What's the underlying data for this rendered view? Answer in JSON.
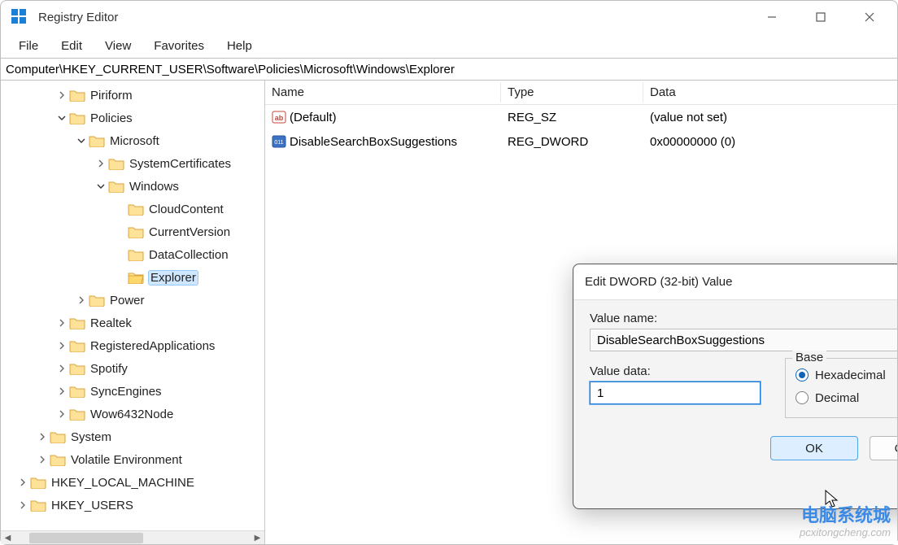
{
  "title": "Registry Editor",
  "menubar": [
    "File",
    "Edit",
    "View",
    "Favorites",
    "Help"
  ],
  "address": "Computer\\HKEY_CURRENT_USER\\Software\\Policies\\Microsoft\\Windows\\Explorer",
  "tree": [
    {
      "indent": 48,
      "exp": "right",
      "label": "Piriform"
    },
    {
      "indent": 48,
      "exp": "down",
      "label": "Policies"
    },
    {
      "indent": 72,
      "exp": "down",
      "label": "Microsoft"
    },
    {
      "indent": 96,
      "exp": "right",
      "label": "SystemCertificates"
    },
    {
      "indent": 96,
      "exp": "down",
      "label": "Windows"
    },
    {
      "indent": 120,
      "exp": "",
      "label": "CloudContent"
    },
    {
      "indent": 120,
      "exp": "",
      "label": "CurrentVersion"
    },
    {
      "indent": 120,
      "exp": "",
      "label": "DataCollection"
    },
    {
      "indent": 120,
      "exp": "",
      "label": "Explorer",
      "selected": true,
      "open": true
    },
    {
      "indent": 72,
      "exp": "right",
      "label": "Power"
    },
    {
      "indent": 48,
      "exp": "right",
      "label": "Realtek"
    },
    {
      "indent": 48,
      "exp": "right",
      "label": "RegisteredApplications"
    },
    {
      "indent": 48,
      "exp": "right",
      "label": "Spotify"
    },
    {
      "indent": 48,
      "exp": "right",
      "label": "SyncEngines"
    },
    {
      "indent": 48,
      "exp": "right",
      "label": "Wow6432Node"
    },
    {
      "indent": 24,
      "exp": "right",
      "label": "System"
    },
    {
      "indent": 24,
      "exp": "right",
      "label": "Volatile Environment"
    },
    {
      "indent": 0,
      "exp": "right",
      "label": "HKEY_LOCAL_MACHINE"
    },
    {
      "indent": 0,
      "exp": "right",
      "label": "HKEY_USERS"
    }
  ],
  "list": {
    "headers": {
      "name": "Name",
      "type": "Type",
      "data": "Data"
    },
    "rows": [
      {
        "icon": "str",
        "name": "(Default)",
        "type": "REG_SZ",
        "data": "(value not set)"
      },
      {
        "icon": "bin",
        "name": "DisableSearchBoxSuggestions",
        "type": "REG_DWORD",
        "data": "0x00000000 (0)"
      }
    ]
  },
  "dialog": {
    "title": "Edit DWORD (32-bit) Value",
    "value_name_label": "Value name:",
    "value_name": "DisableSearchBoxSuggestions",
    "value_data_label": "Value data:",
    "value_data": "1",
    "base_label": "Base",
    "hex_label": "Hexadecimal",
    "dec_label": "Decimal",
    "base_selected": "hex",
    "ok": "OK",
    "cancel": "Cancel"
  },
  "watermark": {
    "big": "电脑系统城",
    "small": "pcxitongcheng.com"
  }
}
